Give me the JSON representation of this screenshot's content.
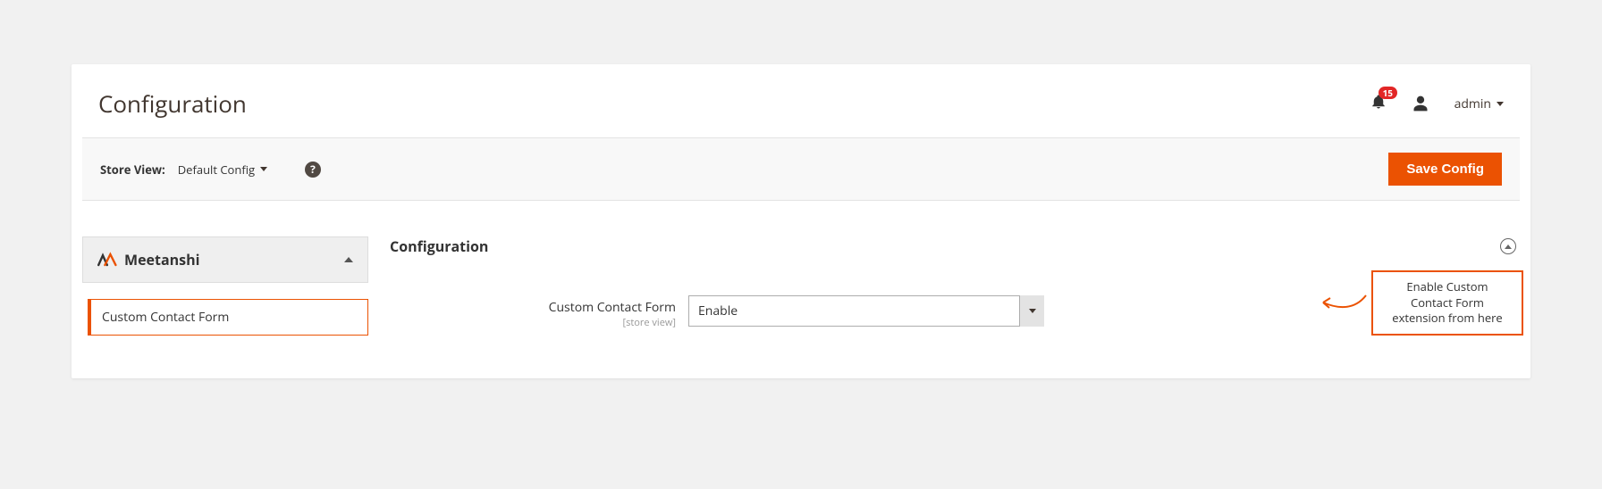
{
  "header": {
    "title": "Configuration",
    "notif_count": "15",
    "admin_user": "admin"
  },
  "toolbar": {
    "store_view_label": "Store View:",
    "store_view_value": "Default Config",
    "save_label": "Save Config"
  },
  "sidebar": {
    "group_name": "Meetanshi",
    "item_label": "Custom Contact Form"
  },
  "section": {
    "title": "Configuration"
  },
  "field": {
    "label": "Custom Contact Form",
    "scope": "[store view]",
    "value": "Enable"
  },
  "callout": {
    "text": "Enable Custom Contact Form extension from here"
  }
}
